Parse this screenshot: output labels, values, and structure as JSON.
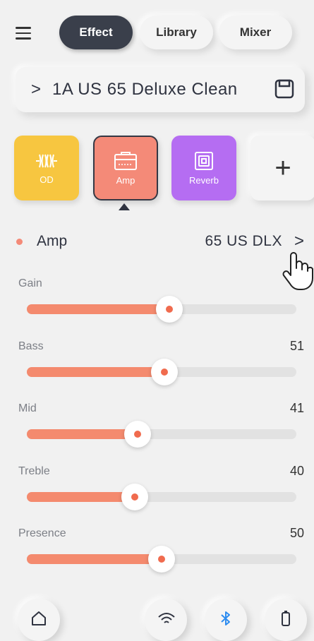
{
  "tabs": [
    {
      "label": "Effect",
      "active": true
    },
    {
      "label": "Library",
      "active": false
    },
    {
      "label": "Mixer",
      "active": false
    }
  ],
  "preset": {
    "chevron": ">",
    "name": "1A  US 65 Deluxe Clean",
    "save_icon": "save-icon"
  },
  "effects": [
    {
      "label": "OD",
      "color": "#f7c640",
      "icon": "overdrive-icon"
    },
    {
      "label": "Amp",
      "color": "#f48a78",
      "icon": "amp-icon",
      "selected": true
    },
    {
      "label": "Reverb",
      "color": "#b56df2",
      "icon": "reverb-icon"
    },
    {
      "label": "+",
      "icon": "add-icon"
    }
  ],
  "amp": {
    "title": "Amp",
    "model": "65 US DLX",
    "chevron": ">"
  },
  "params": [
    {
      "label": "Gain",
      "value": "",
      "level": 0.53
    },
    {
      "label": "Bass",
      "value": "51",
      "level": 0.51
    },
    {
      "label": "Mid",
      "value": "41",
      "level": 0.41
    },
    {
      "label": "Treble",
      "value": "40",
      "level": 0.4
    },
    {
      "label": "Presence",
      "value": "50",
      "level": 0.5
    }
  ],
  "bottom_nav": [
    "home-icon",
    "wifi-icon",
    "bluetooth-icon",
    "battery-icon"
  ],
  "colors": {
    "accent": "#f48a6e",
    "dark": "#3a3f4b",
    "od": "#f7c640",
    "amp": "#f48a78",
    "reverb": "#b56df2"
  }
}
